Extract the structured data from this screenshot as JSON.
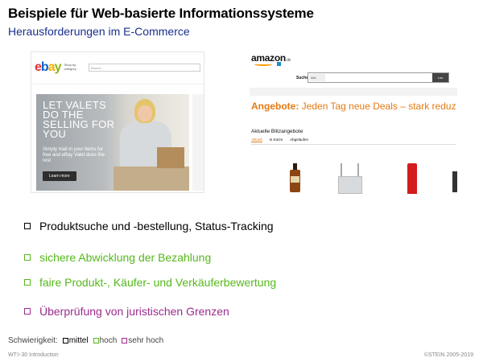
{
  "header": {
    "title": "Beispiele für Web-basierte Informationssysteme",
    "subtitle": "Herausforderungen im E-Commerce"
  },
  "ebay": {
    "logo": "ebay",
    "shop_by": "Shop by category",
    "search_placeholder": "Search...",
    "hero_text": "LET VALETS DO THE SELLING FOR YOU",
    "hero_subtext": "Simply mail in your items for free and eBay Valet does the rest",
    "learn_more": "Learn more"
  },
  "amazon": {
    "logo": "amazon",
    "search_label": "Suche",
    "search_category": "Alle",
    "search_button": "Los",
    "offer_prefix": "Angebote:",
    "offer_text": "Jeden Tag neue Deals – stark reduz",
    "deals_title": "Aktuelle Blitzangebote",
    "tabs": [
      "Aktuell",
      "In Kürze",
      "Abgelaufen"
    ]
  },
  "bullets": [
    {
      "text": "Produktsuche und -bestellung, Status-Tracking",
      "level": "mittel",
      "color": "#000000"
    },
    {
      "text": "sichere Abwicklung der Bezahlung",
      "level": "hoch",
      "color": "#55b81b"
    },
    {
      "text": "faire Produkt-, Käufer- und Verkäuferbewertung",
      "level": "hoch",
      "color": "#55b81b"
    },
    {
      "text": "Überprüfung von juristischen Grenzen",
      "level": "sehr hoch",
      "color": "#9c2b8e"
    }
  ],
  "legend": {
    "label": "Schwierigkeit:",
    "items": [
      "mittel",
      "hoch",
      "sehr hoch"
    ]
  },
  "footer": {
    "left": "WT:I-30   Introduction",
    "right": "©STEIN 2005-2019"
  }
}
